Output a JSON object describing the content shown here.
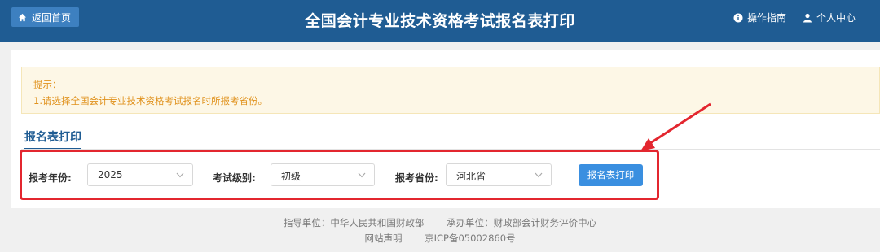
{
  "header": {
    "home_label": "返回首页",
    "title": "全国会计专业技术资格考试报名表打印",
    "guide_label": "操作指南",
    "user_label": "个人中心"
  },
  "notice": {
    "title": "提示：",
    "text": "1.请选择全国会计专业技术资格考试报名时所报考省份。"
  },
  "tab": {
    "label": "报名表打印"
  },
  "form": {
    "year_label": "报考年份:",
    "year_value": "2025",
    "level_label": "考试级别:",
    "level_value": "初级",
    "province_label": "报考省份:",
    "province_value": "河北省",
    "submit_label": "报名表打印"
  },
  "footer": {
    "guide_unit": "指导单位：中华人民共和国财政部",
    "host_unit": "承办单位：财政部会计财务评价中心",
    "statement": "网站声明",
    "icp": "京ICP备05002860号"
  },
  "colors": {
    "header_bg": "#1f5c93",
    "highlight_red": "#e3262f",
    "button_blue": "#3a8fe0",
    "notice_text": "#e0921d"
  }
}
